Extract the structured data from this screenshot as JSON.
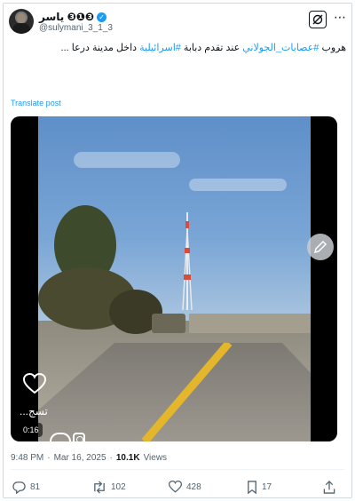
{
  "tweet": {
    "display_name": "ياسر ❸❶❸",
    "handle": "@sulymani_3_1_3",
    "verified": true,
    "text_prefix": "هروب ",
    "hashtag_1": "#عصابات_الجولاني",
    "text_middle": " عند تقدم دبابة ",
    "hashtag_2": "#اسرائيلية",
    "text_suffix": " داخل مدينة درعا ...",
    "translate_label": "Translate post",
    "time": "9:48 PM",
    "separator": "·",
    "date": "Mar 16, 2025",
    "separator_2": "·",
    "views_count": "10.1K",
    "views_label": "Views"
  },
  "media": {
    "duration": "0:16",
    "overlay_label": "تسج...",
    "progress_fraction": 0.0
  },
  "actions": {
    "replies": "81",
    "reposts": "102",
    "likes": "428",
    "bookmarks": "17"
  },
  "colors": {
    "accent": "#1d9bf0",
    "text": "#0f1419",
    "secondary": "#536471"
  },
  "icons": {
    "verified": "verified-badge-icon",
    "grok": "grok-icon",
    "more": "more-icon",
    "edit": "edit-icon",
    "reply": "reply-icon",
    "repost": "repost-icon",
    "like": "like-icon",
    "bookmark": "bookmark-icon",
    "share": "share-icon"
  }
}
